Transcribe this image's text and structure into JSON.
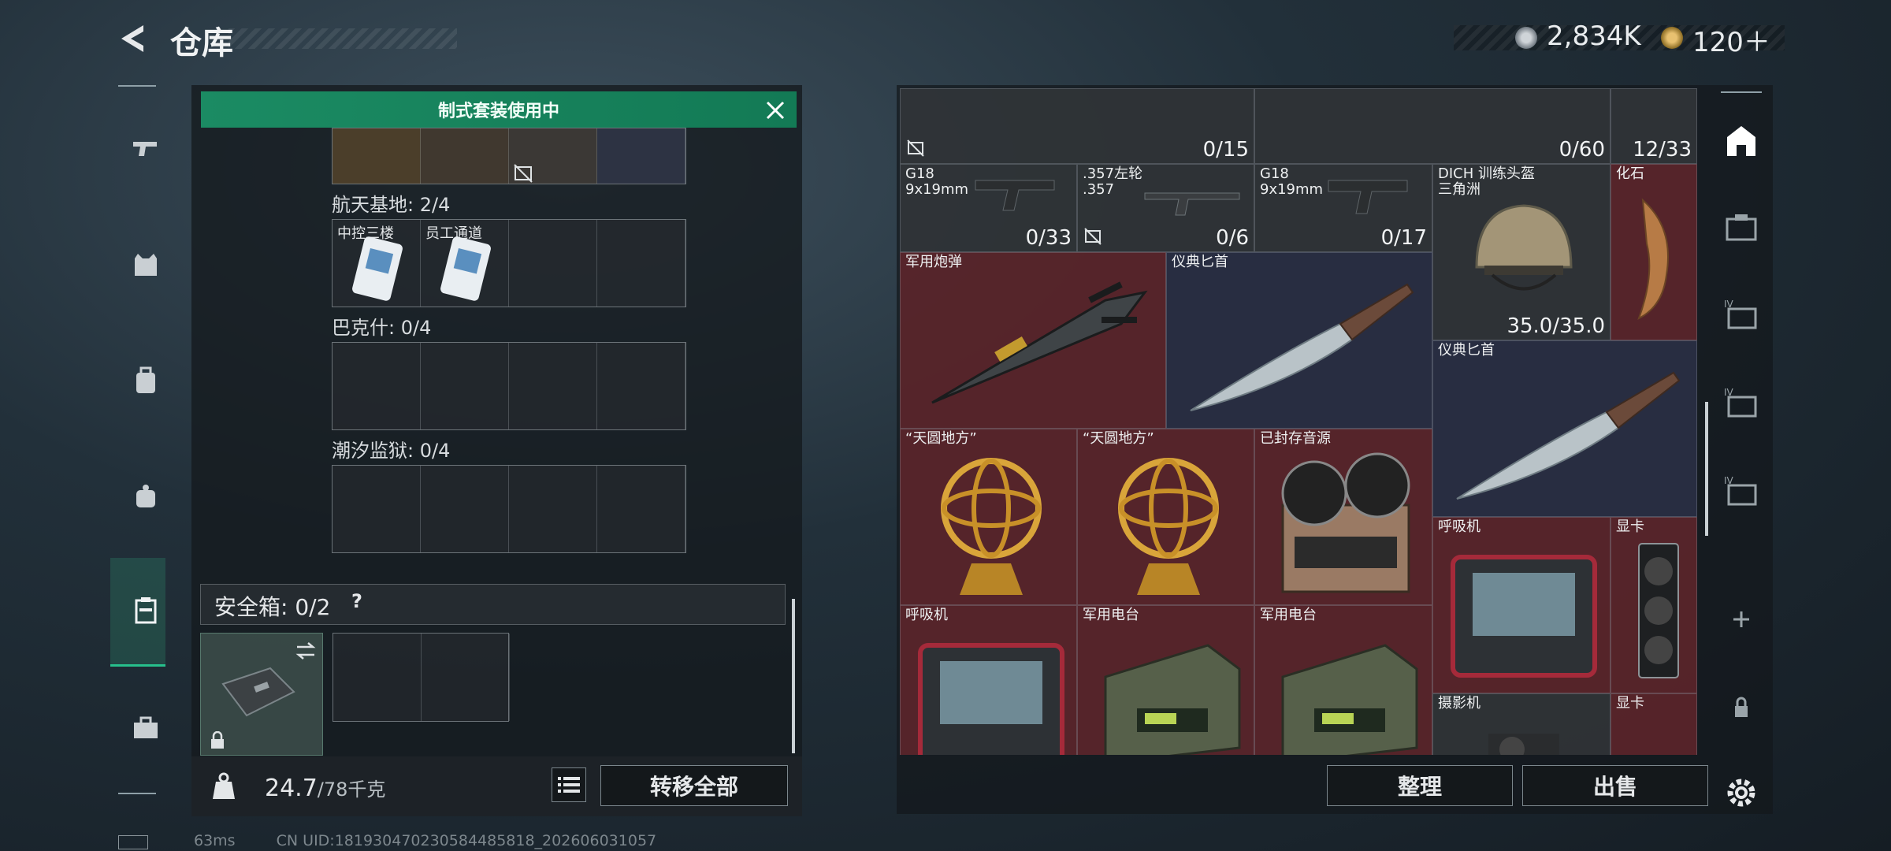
{
  "header": {
    "title": "仓库",
    "currency": [
      {
        "icon": "silver-coin-icon",
        "value": "2,834K"
      },
      {
        "icon": "gold-coin-icon",
        "value": "120＋"
      }
    ]
  },
  "left_nav": [
    "pistol-icon",
    "vest-icon",
    "backpack-icon",
    "pouch-icon",
    "safebox-icon",
    "toolbox-icon"
  ],
  "left_panel": {
    "banner": "制式套装使用中",
    "sections": [
      {
        "label": "航天基地: 2/4",
        "slots": [
          {
            "label": "中控三楼"
          },
          {
            "label": "员工通道"
          },
          {},
          {}
        ]
      },
      {
        "label": "巴克什: 0/4",
        "slots": [
          {},
          {},
          {},
          {}
        ]
      },
      {
        "label": "潮汐监狱: 0/4",
        "slots": [
          {},
          {},
          {},
          {}
        ]
      }
    ],
    "safebox": {
      "label": "安全箱:  0/2",
      "help": "?"
    },
    "weight": {
      "value": "24.7",
      "max": "/78千克"
    },
    "transfer_all": "转移全部"
  },
  "grid_items": [
    {
      "name": "",
      "count": "0/15"
    },
    {
      "name": "",
      "count": "0/60"
    },
    {
      "name": "",
      "count": "12/33"
    },
    {
      "name": "G18\n9x19mm",
      "count": "0/33"
    },
    {
      "name": ".357左轮\n.357",
      "count": "0/6"
    },
    {
      "name": "G18\n9x19mm",
      "count": "0/17"
    },
    {
      "name": "DICH 训练头盔\n三角洲",
      "count": "35.0/35.0"
    },
    {
      "name": "化石",
      "count": ""
    },
    {
      "name": "军用炮弹",
      "count": ""
    },
    {
      "name": "仪典匕首",
      "count": ""
    },
    {
      "name": "仪典匕首",
      "count": ""
    },
    {
      "name": "“天圆地方”",
      "count": ""
    },
    {
      "name": "“天圆地方”",
      "count": ""
    },
    {
      "name": "已封存音源",
      "count": ""
    },
    {
      "name": "呼吸机",
      "count": ""
    },
    {
      "name": "显卡",
      "count": ""
    },
    {
      "name": "呼吸机",
      "count": ""
    },
    {
      "name": "军用电台",
      "count": ""
    },
    {
      "name": "军用电台",
      "count": ""
    },
    {
      "name": "摄影机",
      "count": ""
    },
    {
      "name": "显卡",
      "count": ""
    }
  ],
  "right_panel": {
    "sort": "整理",
    "sell": "出售"
  },
  "right_nav": [
    "home-icon",
    "case-icon",
    "case-iv-icon",
    "case-iv-2-icon",
    "case-iv-3-icon",
    "plus-icon",
    "lock-icon",
    "gear-icon"
  ],
  "footer": {
    "ping": "63ms",
    "uid": "CN UID:18193047023058448581​8_202606031057"
  }
}
